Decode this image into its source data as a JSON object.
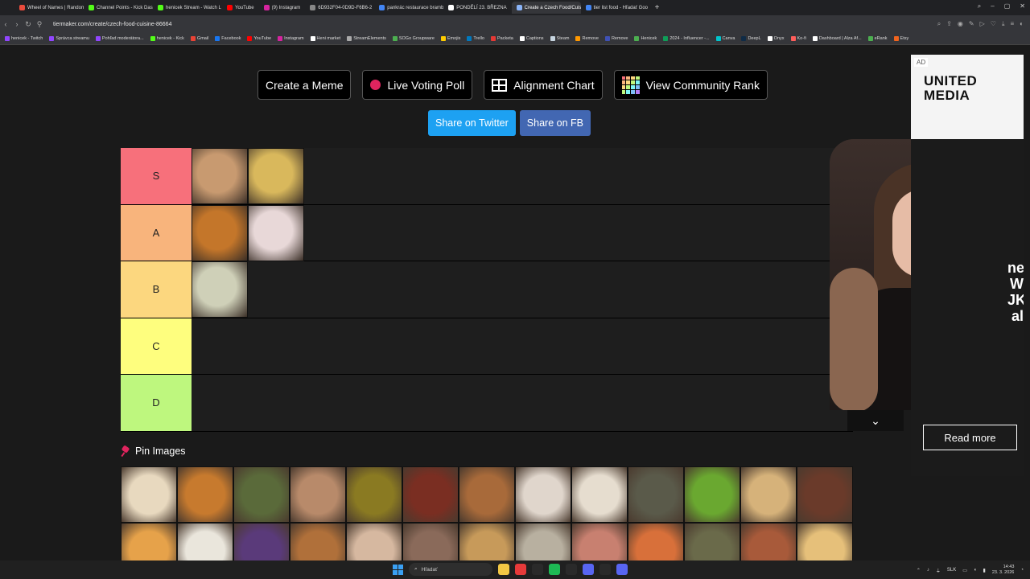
{
  "browser": {
    "tabs": [
      {
        "label": "Wheel of Names | Random",
        "color": "#e94b3c",
        "active": false
      },
      {
        "label": "Channel Points - Kick Das",
        "color": "#53fc18",
        "active": false
      },
      {
        "label": "henicek Stream - Watch L",
        "color": "#53fc18",
        "active": false
      },
      {
        "label": "YouTube",
        "color": "#ff0000",
        "active": false
      },
      {
        "label": "(9) Instagram",
        "color": "#d6249f",
        "active": false
      },
      {
        "label": "6D932F04-0D9D-F6B6-2",
        "color": "#888888",
        "active": false
      },
      {
        "label": "pankrác restaurace brambo",
        "color": "#4285f4",
        "active": false
      },
      {
        "label": "PONDĚLÍ 23. BŘEZNA",
        "color": "#ffffff",
        "active": false
      },
      {
        "label": "Create a Czech Food/Cuis",
        "color": "#8ab4f8",
        "active": true
      },
      {
        "label": "tier list food - Hľadať Goo",
        "color": "#4285f4",
        "active": false
      }
    ],
    "url": "tiermaker.com/create/czech-food-cuisine-86664",
    "bookmarks": [
      {
        "label": "henicek - Twitch",
        "color": "#9146ff"
      },
      {
        "label": "Správca streamu",
        "color": "#9146ff"
      },
      {
        "label": "Pohľad moderátora...",
        "color": "#9146ff"
      },
      {
        "label": "henicek - Kick",
        "color": "#53fc18"
      },
      {
        "label": "Gmail",
        "color": "#ea4335"
      },
      {
        "label": "Facebook",
        "color": "#1877f2"
      },
      {
        "label": "YouTube",
        "color": "#ff0000"
      },
      {
        "label": "Instagram",
        "color": "#d6249f"
      },
      {
        "label": "Heni market",
        "color": "#ffffff"
      },
      {
        "label": "StreamElements",
        "color": "#aaaaaa"
      },
      {
        "label": "SOGo Groupware",
        "color": "#4caf50"
      },
      {
        "label": "Emojis",
        "color": "#ffcc00"
      },
      {
        "label": "Trello",
        "color": "#0079bf"
      },
      {
        "label": "Packeta",
        "color": "#e53935"
      },
      {
        "label": "Captions",
        "color": "#ffffff"
      },
      {
        "label": "Steam",
        "color": "#c7d5e0"
      },
      {
        "label": "Remove",
        "color": "#ff9800"
      },
      {
        "label": "Remove",
        "color": "#3f51b5"
      },
      {
        "label": "Henicek",
        "color": "#4caf50"
      },
      {
        "label": "2024 - Influencer -...",
        "color": "#0f9d58"
      },
      {
        "label": "Canva",
        "color": "#00c4cc"
      },
      {
        "label": "DeepL",
        "color": "#0f2b46"
      },
      {
        "label": "Onyx",
        "color": "#ffffff"
      },
      {
        "label": "Ko-fi",
        "color": "#ff5e5b"
      },
      {
        "label": "Dashboard | Alza Af...",
        "color": "#ffffff"
      },
      {
        "label": "eRank",
        "color": "#4caf50"
      },
      {
        "label": "Etsy",
        "color": "#f1641e"
      }
    ]
  },
  "toolbar": {
    "create_meme": "Create a Meme",
    "live_poll": "Live Voting Poll",
    "alignment": "Alignment Chart",
    "community": "View Community Rank",
    "share_twitter": "Share on Twitter",
    "share_fb": "Share on FB"
  },
  "tiers": [
    {
      "label": "S",
      "color": "#f7707b",
      "items": [
        "#c89a70",
        "#d9b85c"
      ]
    },
    {
      "label": "A",
      "color": "#f8b47c",
      "items": [
        "#c4762a",
        "#e8d8d8"
      ]
    },
    {
      "label": "B",
      "color": "#fcd77f",
      "items": [
        "#cfd0b8"
      ]
    },
    {
      "label": "C",
      "color": "#fefe7e",
      "items": []
    },
    {
      "label": "D",
      "color": "#bef77e",
      "items": []
    }
  ],
  "pin_images": {
    "label": "Pin Images",
    "pool": [
      "#e8d9bf",
      "#c77a2e",
      "#5a6a3a",
      "#b88a6a",
      "#8a7a22",
      "#7a2e22",
      "#a86a3a",
      "#e0d6cc",
      "#e6ddcf",
      "#5a5a4a",
      "#6aa830",
      "#d6b27a",
      "#6a3a2a",
      "#e6a24a",
      "#eae6dc",
      "#5a3a7a",
      "#b0703a",
      "#d6b8a0",
      "#8a6a5a",
      "#c79a5a",
      "#b8b0a0",
      "#c88070",
      "#d8703a",
      "#6a6a4a",
      "#a85a3a",
      "#e6c07a"
    ]
  },
  "ad": {
    "badge": "AD",
    "brand": "UNITED MEDIA",
    "fragment": "ne W JK al",
    "cta": "Read more"
  },
  "taskbar": {
    "search_placeholder": "Hľadať",
    "lang": "SLK",
    "time": "14:43",
    "date": "23. 3. 2026",
    "apps": [
      "#f2c744",
      "#e63a3a",
      "#2a2a2a",
      "#1db954",
      "#2a2a2a",
      "#5865f2",
      "#2a2a2a",
      "#5865f2"
    ]
  }
}
